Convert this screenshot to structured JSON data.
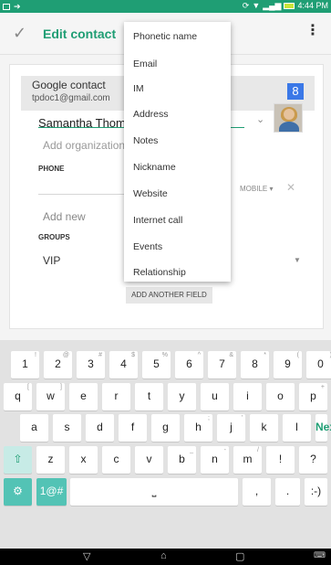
{
  "status_bar": {
    "time": "4:44 PM"
  },
  "app_bar": {
    "title": "Edit contact"
  },
  "account": {
    "type": "Google contact",
    "email": "tpdoc1@gmail.com",
    "badge": "8"
  },
  "name_value": "Samantha Thomps",
  "fields": {
    "add_organization": "Add organization",
    "phone_header": "PHONE",
    "phone_type": "MOBILE ▾",
    "add_new": "Add new",
    "groups_header": "GROUPS",
    "group_value": "VIP"
  },
  "menu": {
    "items": [
      "Phonetic name",
      "Email",
      "IM",
      "Address",
      "Notes",
      "Nickname",
      "Website",
      "Internet call",
      "Events",
      "Relationship"
    ]
  },
  "add_field_button": "ADD ANOTHER FIELD",
  "keyboard": {
    "row1": [
      [
        "1",
        "!"
      ],
      [
        "2",
        "@"
      ],
      [
        "3",
        "#"
      ],
      [
        "4",
        "$"
      ],
      [
        "5",
        "%"
      ],
      [
        "6",
        "^"
      ],
      [
        "7",
        "&"
      ],
      [
        "8",
        "*"
      ],
      [
        "9",
        "("
      ],
      [
        "0",
        ")"
      ]
    ],
    "row2": [
      [
        "q",
        "["
      ],
      [
        "w",
        "]"
      ],
      [
        "e",
        ""
      ],
      [
        "r",
        ""
      ],
      [
        "t",
        ""
      ],
      [
        "y",
        ""
      ],
      [
        "u",
        ""
      ],
      [
        "i",
        ""
      ],
      [
        "o",
        ""
      ],
      [
        "p",
        "+"
      ]
    ],
    "row3": [
      [
        "a",
        ""
      ],
      [
        "s",
        ""
      ],
      [
        "d",
        ""
      ],
      [
        "f",
        ""
      ],
      [
        "g",
        ""
      ],
      [
        "h",
        ";"
      ],
      [
        "j",
        "'"
      ],
      [
        "k",
        ""
      ],
      [
        "l",
        ""
      ]
    ],
    "row4": [
      [
        "z",
        ""
      ],
      [
        "x",
        ""
      ],
      [
        "c",
        ""
      ],
      [
        "v",
        ""
      ],
      [
        "b",
        "_"
      ],
      [
        "n",
        "-"
      ],
      [
        "m",
        "/"
      ],
      [
        "!",
        ""
      ],
      [
        "?",
        ""
      ]
    ],
    "next_label": "Next",
    "symbols_label": "1@#",
    "comma": ",",
    "period": ".",
    "smiley": ":-)",
    "space_label": "⎵"
  }
}
